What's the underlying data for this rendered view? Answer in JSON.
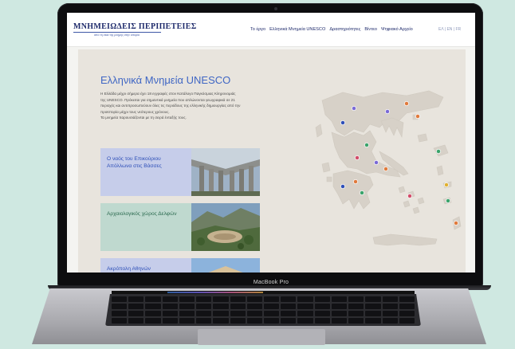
{
  "device": {
    "brand_label": "MacBook Pro"
  },
  "site": {
    "logo": {
      "title": "ΜΝΗΜΕΙΩΔΕΙΣ ΠΕΡΙΠΕΤΕΙΕΣ",
      "subtitle": "από τη σκιά της μνήμης στην ιστορία"
    },
    "nav": {
      "items": [
        "Το έργο",
        "Ελληνικά Μνημεία UNESCO",
        "Δραστηριότητες",
        "Βίντεο",
        "Ψηφιακό Αρχείο"
      ]
    },
    "lang": "ΕΛ | EN | FR"
  },
  "main": {
    "title": "Ελληνικά Μνημεία UNESCO",
    "intro_lines": [
      "Η Ελλάδα μέχρι σήμερα έχει 18 εγγραφές στον Κατάλογο Παγκόσμιας Κληρονομιάς",
      "της UNESCO. Πρόκειται για σημαντικά μνημεία που απλώνονται γεωγραφικά σε 21",
      "περιοχές και αντιπροσωπεύουν όλες τις περιόδους της ελληνικής δημιουργίας από την",
      "προϊστορία μέχρι τους νεότερους χρόνους.",
      "Τα μνημεία παρουσιάζονται με τη σειρά ένταξής τους."
    ],
    "cards": [
      {
        "title": "Ο ναός του Επικούριου Απόλλωνα στις Βάσσες"
      },
      {
        "title": "Αρχαιολογικός χώρος Δελφών"
      },
      {
        "title": "Ακρόπολη Αθηνών"
      }
    ]
  },
  "colors": {
    "background": "#cfe8e1",
    "page_bg": "#e8e4dd",
    "title_blue": "#3f66c4",
    "nav_navy": "#1e2a6b",
    "card_blue": "#c6cdea",
    "card_green": "#bfd9cf",
    "map_land": "#d7d1c8"
  }
}
